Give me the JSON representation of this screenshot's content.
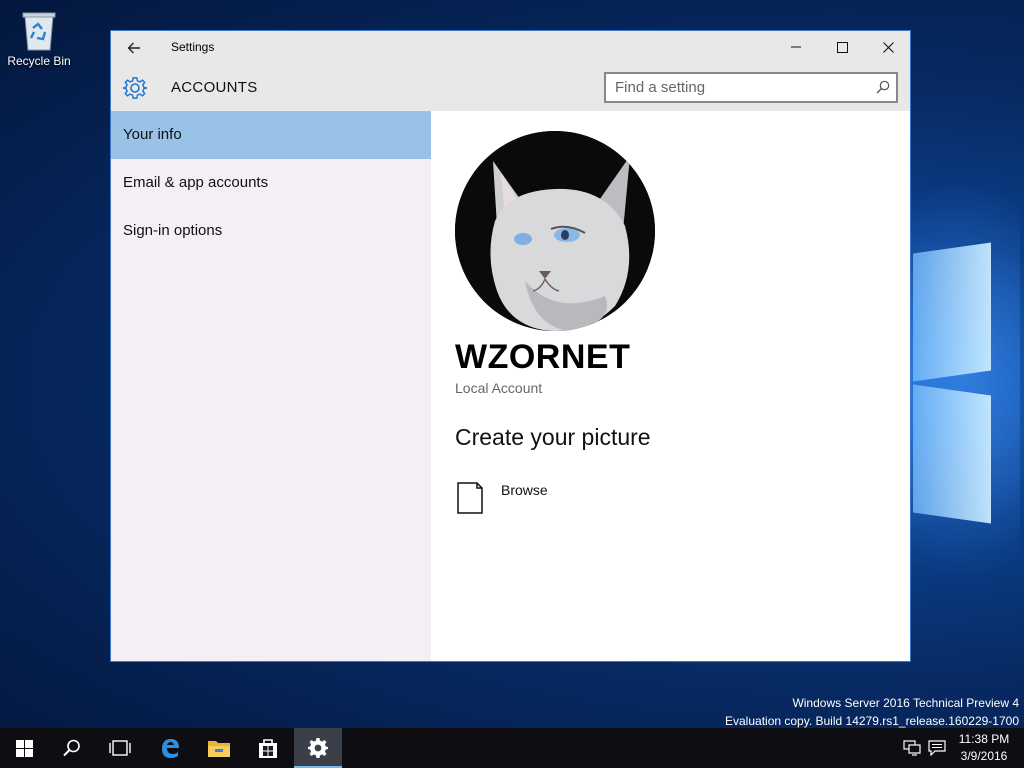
{
  "desktop": {
    "recycle_bin_label": "Recycle Bin",
    "watermark_line1": "Windows Server 2016 Technical Preview 4",
    "watermark_line2": "Evaluation copy. Build 14279.rs1_release.160229-1700"
  },
  "window": {
    "title": "Settings",
    "section_title": "ACCOUNTS",
    "search": {
      "placeholder": "Find a setting",
      "value": ""
    },
    "accent_color": "#98c3e6"
  },
  "sidebar": {
    "items": [
      {
        "label": "Your info",
        "selected": true
      },
      {
        "label": "Email & app accounts",
        "selected": false
      },
      {
        "label": "Sign-in options",
        "selected": false
      }
    ]
  },
  "content": {
    "username": "WZORNET",
    "account_type": "Local Account",
    "create_picture_heading": "Create your picture",
    "browse_label": "Browse"
  },
  "taskbar": {
    "buttons": [
      "start-icon",
      "search-icon",
      "task-view-icon",
      "edge-icon",
      "file-explorer-icon",
      "store-icon",
      "settings-icon"
    ],
    "active_button": "settings-icon",
    "time": "11:38 PM",
    "date": "3/9/2016"
  }
}
